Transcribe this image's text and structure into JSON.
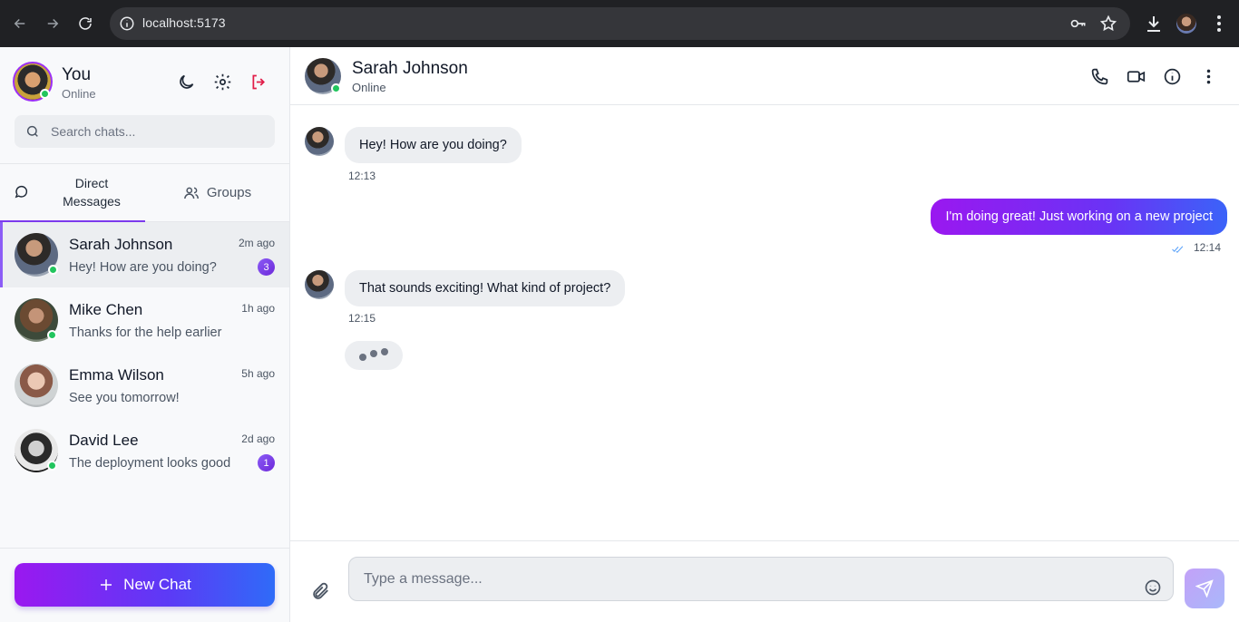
{
  "browser": {
    "url": "localhost:5173"
  },
  "me": {
    "name": "You",
    "status": "Online"
  },
  "search": {
    "placeholder": "Search chats..."
  },
  "tabs": {
    "direct_line1": "Direct",
    "direct_line2": "Messages",
    "groups": "Groups"
  },
  "chats": [
    {
      "name": "Sarah Johnson",
      "time": "2m ago",
      "preview": "Hey! How are you doing?",
      "unread": "3",
      "online": true
    },
    {
      "name": "Mike Chen",
      "time": "1h ago",
      "preview": "Thanks for the help earlier",
      "unread": "",
      "online": true
    },
    {
      "name": "Emma Wilson",
      "time": "5h ago",
      "preview": "See you tomorrow!",
      "unread": "",
      "online": false
    },
    {
      "name": "David Lee",
      "time": "2d ago",
      "preview": "The deployment looks good",
      "unread": "1",
      "online": true
    }
  ],
  "new_chat_label": "New Chat",
  "conversation": {
    "peer_name": "Sarah Johnson",
    "peer_status": "Online",
    "messages": [
      {
        "direction": "in",
        "text": "Hey! How are you doing?",
        "time": "12:13"
      },
      {
        "direction": "out",
        "text": "I'm doing great! Just working on a new project",
        "time": "12:14"
      },
      {
        "direction": "in",
        "text": "That sounds exciting! What kind of project?",
        "time": "12:15"
      }
    ]
  },
  "composer": {
    "placeholder": "Type a message..."
  },
  "colors": {
    "accent_purple": "#9a18f0",
    "accent_blue": "#2f6bf8",
    "online_green": "#22c55e",
    "logout_red": "#e11d48"
  }
}
